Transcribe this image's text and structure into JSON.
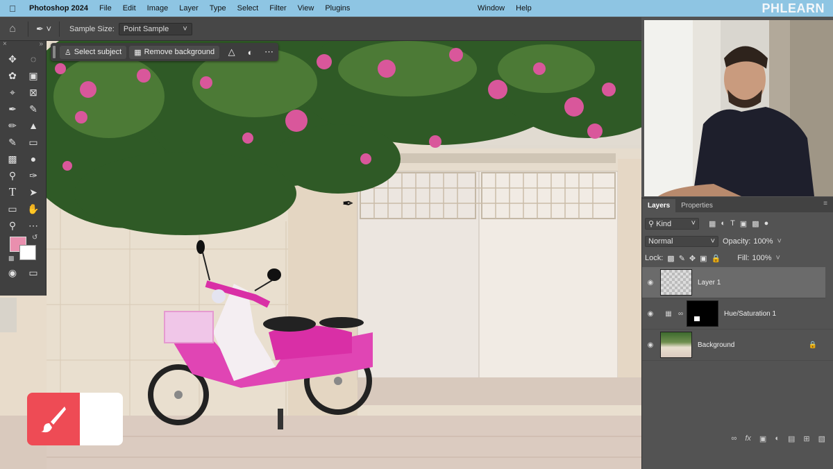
{
  "menubar": {
    "app_name": "Photoshop 2024",
    "items": [
      "File",
      "Edit",
      "Image",
      "Layer",
      "Type",
      "Select",
      "Filter",
      "View",
      "Plugins"
    ],
    "right_items": [
      "Window",
      "Help"
    ],
    "brand": "PHLEARN"
  },
  "options_bar": {
    "sample_size_label": "Sample Size:",
    "sample_size_value": "Point Sample"
  },
  "task_bar": {
    "select_subject": "Select subject",
    "remove_background": "Remove background"
  },
  "colors": {
    "foreground": "#e98fae",
    "background": "#ffffff",
    "brand_red": "#ee4b55"
  },
  "layers_panel": {
    "tabs": [
      "Layers",
      "Properties"
    ],
    "filter_kind": "Kind",
    "blend_mode": "Normal",
    "opacity_label": "Opacity:",
    "opacity_value": "100%",
    "lock_label": "Lock:",
    "fill_label": "Fill:",
    "fill_value": "100%",
    "layers": [
      {
        "name": "Layer 1",
        "selected": true
      },
      {
        "name": "Hue/Saturation 1",
        "selected": false
      },
      {
        "name": "Background",
        "selected": false,
        "locked": true
      }
    ]
  }
}
